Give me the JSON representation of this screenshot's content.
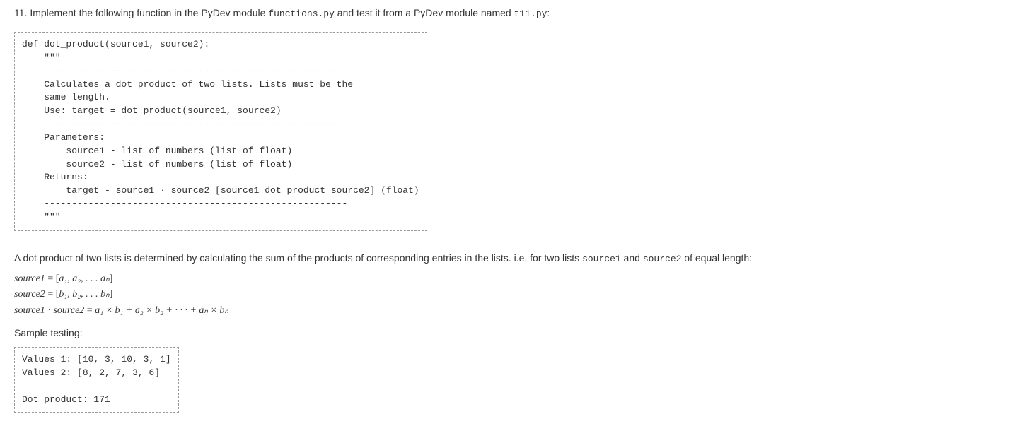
{
  "question": {
    "number": "11.",
    "intro_before_code1": " Implement the following function in the PyDev module ",
    "code1": "functions.py",
    "intro_mid": " and test it from a PyDev module named ",
    "code2": "t11.py",
    "intro_after": ":"
  },
  "code_block": "def dot_product(source1, source2):\n    \"\"\"\n    -------------------------------------------------------\n    Calculates a dot product of two lists. Lists must be the\n    same length.\n    Use: target = dot_product(source1, source2)\n    -------------------------------------------------------\n    Parameters:\n        source1 - list of numbers (list of float)\n        source2 - list of numbers (list of float)\n    Returns:\n        target - source1 · source2 [source1 dot product source2] (float)\n    -------------------------------------------------------\n    \"\"\"",
  "explanation": {
    "before_s1": "A dot product of two lists is determined by calculating the sum of the products of corresponding entries in the lists. i.e. for two lists ",
    "s1": "source1",
    "mid": " and ",
    "s2": "source2",
    "after": " of equal length:"
  },
  "math": {
    "line1_lhs": "source1",
    "line1_eq": " = ",
    "line1_rhs_open": "[",
    "line1_rhs_items": "a₁, a₂, . . . aₙ",
    "line1_rhs_close": "]",
    "line2_lhs": "source2",
    "line2_eq": " = ",
    "line2_rhs_open": "[",
    "line2_rhs_items": "b₁, b₂, . . . bₙ",
    "line2_rhs_close": "]",
    "line3_lhs1": "source1",
    "line3_dot": " · ",
    "line3_lhs2": "source2",
    "line3_eq": " = ",
    "line3_rhs": "a₁ × b₁ + a₂ × b₂ + · · · + aₙ × bₙ"
  },
  "sample_label": "Sample testing:",
  "sample_block": "Values 1: [10, 3, 10, 3, 1]\nValues 2: [8, 2, 7, 3, 6]\n\nDot product: 171"
}
